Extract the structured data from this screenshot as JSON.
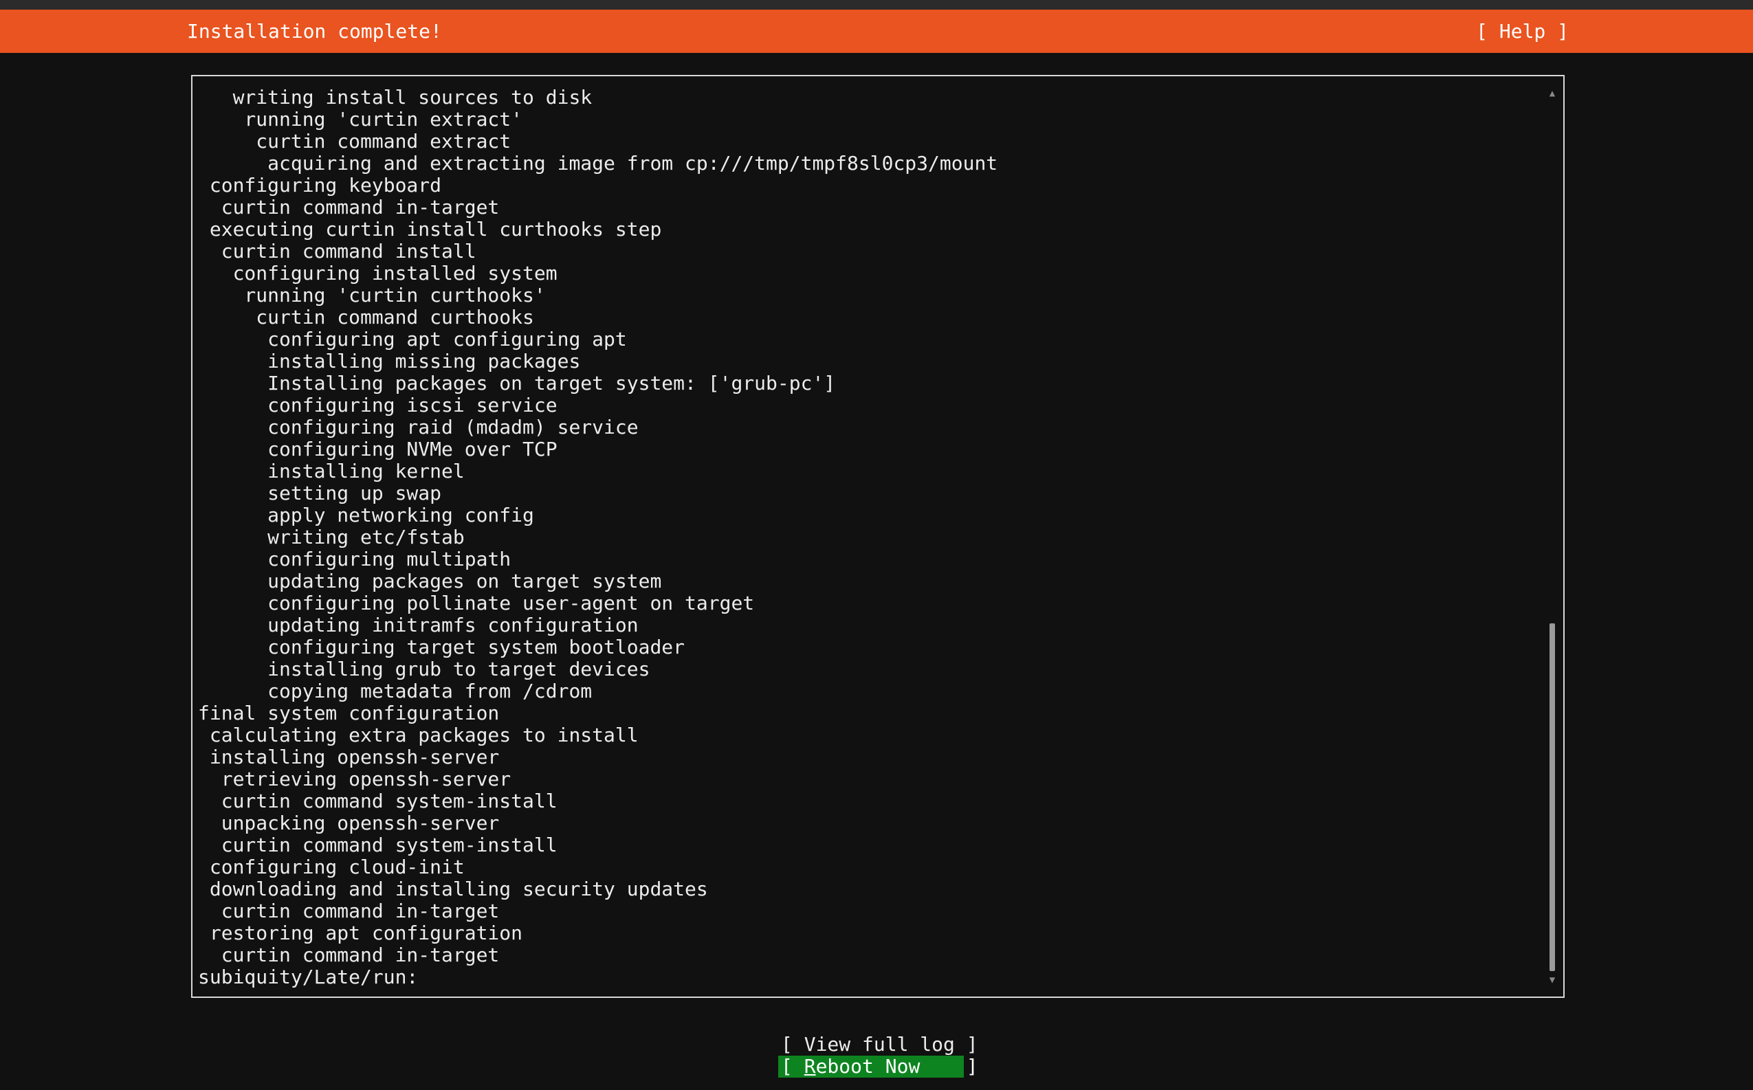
{
  "header": {
    "title": "Installation complete!",
    "help_label": "[ Help ]"
  },
  "log": {
    "lines": [
      "   writing install sources to disk",
      "    running 'curtin extract'",
      "     curtin command extract",
      "      acquiring and extracting image from cp:///tmp/tmpf8sl0cp3/mount",
      " configuring keyboard",
      "  curtin command in-target",
      " executing curtin install curthooks step",
      "  curtin command install",
      "   configuring installed system",
      "    running 'curtin curthooks'",
      "     curtin command curthooks",
      "      configuring apt configuring apt",
      "      installing missing packages",
      "      Installing packages on target system: ['grub-pc']",
      "      configuring iscsi service",
      "      configuring raid (mdadm) service",
      "      configuring NVMe over TCP",
      "      installing kernel",
      "      setting up swap",
      "      apply networking config",
      "      writing etc/fstab",
      "      configuring multipath",
      "      updating packages on target system",
      "      configuring pollinate user-agent on target",
      "      updating initramfs configuration",
      "      configuring target system bootloader",
      "      installing grub to target devices",
      "      copying metadata from /cdrom",
      "final system configuration",
      " calculating extra packages to install",
      " installing openssh-server",
      "  retrieving openssh-server",
      "  curtin command system-install",
      "  unpacking openssh-server",
      "  curtin command system-install",
      " configuring cloud-init",
      " downloading and installing security updates",
      "  curtin command in-target",
      " restoring apt configuration",
      "  curtin command in-target",
      "subiquity/Late/run:"
    ],
    "scroll_up_icon": "▲",
    "scroll_down_icon": "▼",
    "scroll_position": {
      "visible_fraction_start": 0.6,
      "visible_fraction_end": 1.0
    }
  },
  "buttons": {
    "view_log_label": "[ View full log ]",
    "reboot_open": "[ ",
    "reboot_hotkey": "R",
    "reboot_rest": "eboot Now    ]"
  },
  "colors": {
    "header_bg": "#e95420",
    "background": "#111111",
    "focused_button_bg": "#0e8420"
  }
}
